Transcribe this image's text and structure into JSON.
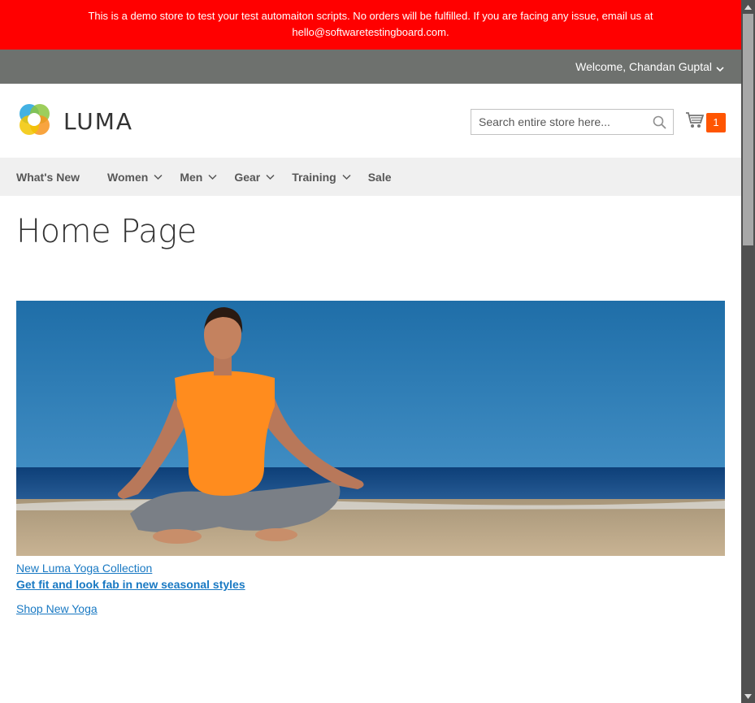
{
  "demo_notice": {
    "line1": "This is a demo store to test your test automaiton scripts. No orders will be fulfilled. If you are facing any issue, email us at",
    "line2": "hello@softwaretestingboard.com."
  },
  "top_bar": {
    "welcome": "Welcome, Chandan Guptal"
  },
  "header": {
    "logo_text": "LUMA",
    "search_placeholder": "Search entire store here...",
    "search_icon": "search-icon",
    "cart_icon": "cart-icon",
    "cart_count": "1"
  },
  "nav": {
    "items": [
      {
        "label": "What's New",
        "has_dropdown": false
      },
      {
        "label": "Women",
        "has_dropdown": true
      },
      {
        "label": "Men",
        "has_dropdown": true
      },
      {
        "label": "Gear",
        "has_dropdown": true
      },
      {
        "label": "Training",
        "has_dropdown": true
      },
      {
        "label": "Sale",
        "has_dropdown": false
      }
    ]
  },
  "main": {
    "title": "Home Page",
    "hero_links": {
      "collection": "New Luma Yoga Collection",
      "tagline": "Get fit and look fab in new seasonal styles",
      "shop": "Shop New Yoga"
    }
  },
  "colors": {
    "demo_bar": "#ff0000",
    "top_bar": "#6e716e",
    "nav_bg": "#f0f0f0",
    "link": "#1979c3",
    "cart_badge": "#ff5501"
  }
}
